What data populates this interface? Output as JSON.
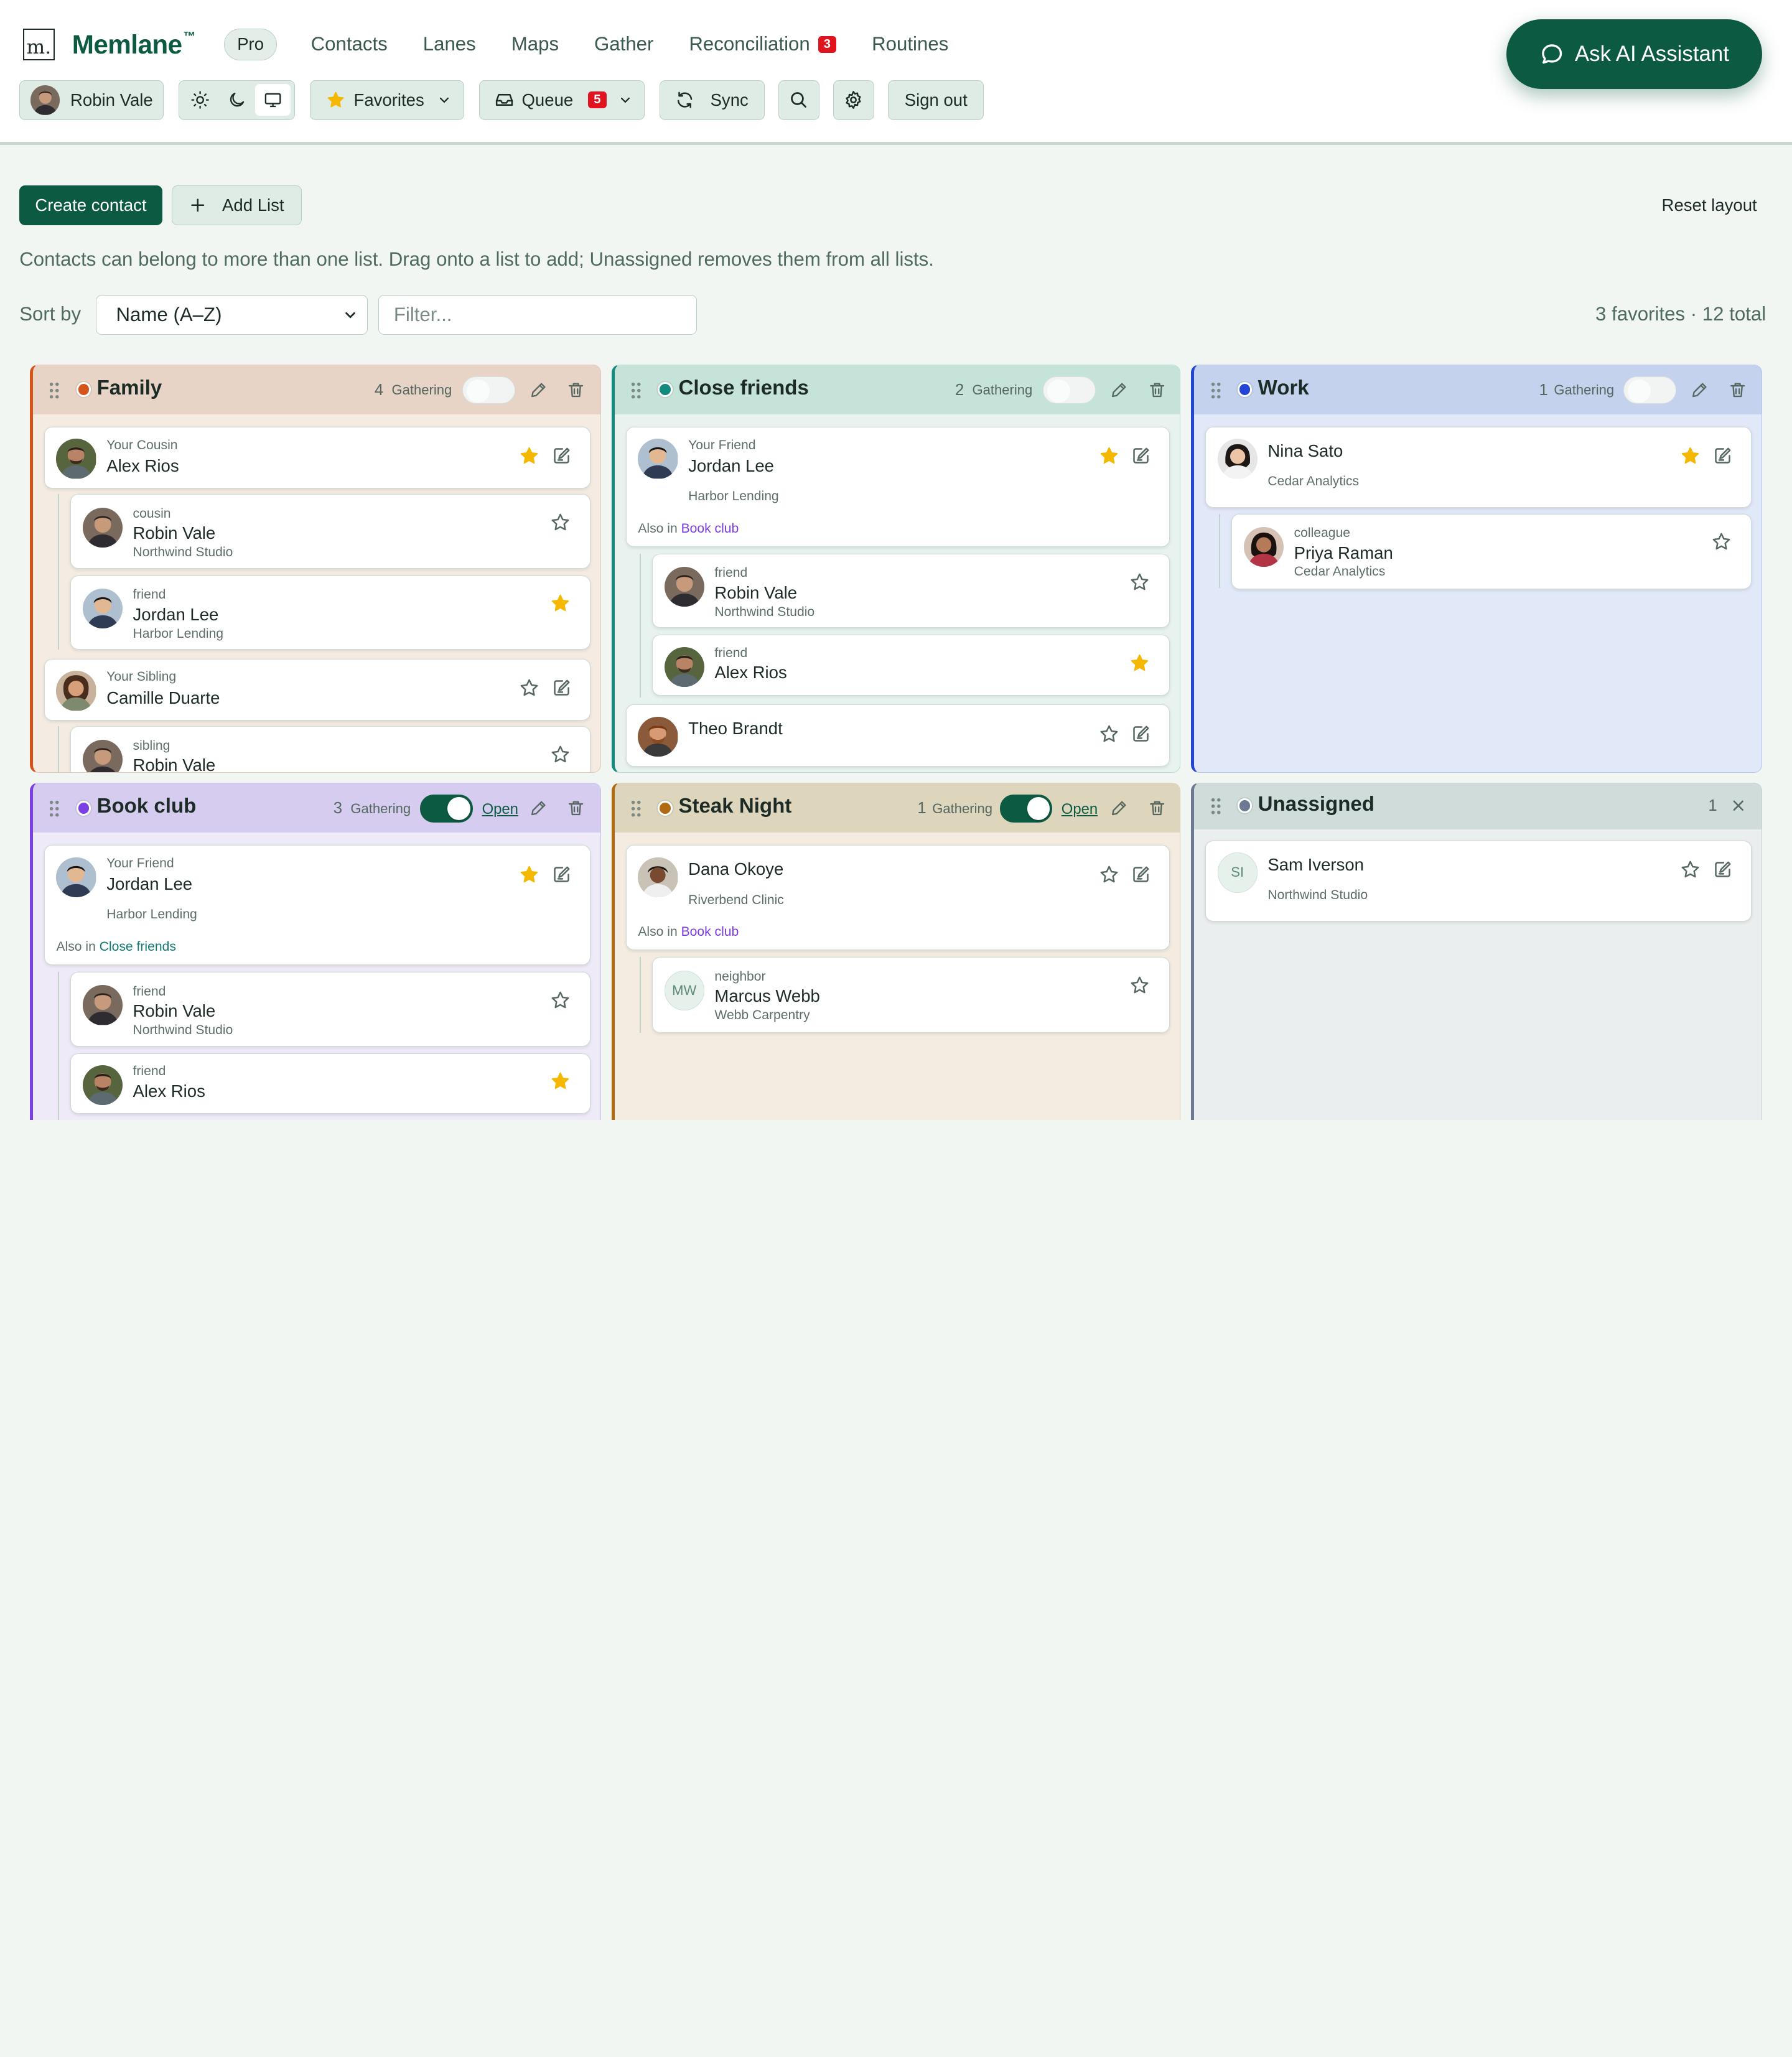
{
  "header": {
    "logo_letter": "m.",
    "brand": "Memlane",
    "trademark": "™",
    "plan": "Pro",
    "nav": [
      {
        "label": "Contacts"
      },
      {
        "label": "Lanes"
      },
      {
        "label": "Maps"
      },
      {
        "label": "Gather"
      },
      {
        "label": "Reconciliation",
        "badge": "3"
      },
      {
        "label": "Routines"
      }
    ],
    "ask_ai": "Ask AI Assistant",
    "user": "Robin Vale",
    "favorites": "Favorites",
    "queue": "Queue",
    "queue_badge": "5",
    "sync": "Sync",
    "sign_out": "Sign out",
    "theme_selected": "system"
  },
  "toolbar": {
    "create_contact": "Create contact",
    "add_list": "Add List",
    "reset_layout": "Reset layout",
    "hint": "Contacts can belong to more than one list. Drag onto a list to add; Unassigned removes them from all lists.",
    "sort_label": "Sort by",
    "sort_value": "Name (A–Z)",
    "filter_placeholder": "Filter...",
    "totals": "3 favorites · 12 total"
  },
  "gathering_label": "Gathering",
  "open_label": "Open",
  "also_in_label": "Also in",
  "colors": {
    "brand": "#0d5a43",
    "family": "#d4541a",
    "close_friends": "#128a7c",
    "work": "#2346d6",
    "book_club": "#7b3fe4",
    "steak_night": "#b06a12",
    "unassigned": "#6d7892",
    "star": "#f5b800"
  },
  "lanes": {
    "family": {
      "title": "Family",
      "count": "4",
      "gathering": false,
      "cards": [
        {
          "role": "Your Cousin",
          "name": "Alex Rios",
          "starred": true
        },
        {
          "role": "cousin",
          "name": "Robin Vale",
          "org": "Northwind Studio",
          "starred": false
        },
        {
          "role": "friend",
          "name": "Jordan Lee",
          "org": "Harbor Lending",
          "starred": true
        },
        {
          "role": "Your Sibling",
          "name": "Camille Duarte",
          "starred": false
        },
        {
          "role": "sibling",
          "name": "Robin Vale",
          "starred": false
        }
      ]
    },
    "close_friends": {
      "title": "Close friends",
      "count": "2",
      "gathering": false,
      "cards": [
        {
          "role": "Your Friend",
          "name": "Jordan Lee",
          "org": "Harbor Lending",
          "also_in": "Book club",
          "starred": true
        },
        {
          "role": "friend",
          "name": "Robin Vale",
          "org": "Northwind Studio",
          "starred": false
        },
        {
          "role": "friend",
          "name": "Alex Rios",
          "starred": true
        },
        {
          "name": "Theo Brandt",
          "starred": false
        }
      ]
    },
    "work": {
      "title": "Work",
      "count": "1",
      "gathering": false,
      "cards": [
        {
          "name": "Nina Sato",
          "org": "Cedar Analytics",
          "starred": true
        },
        {
          "role": "colleague",
          "name": "Priya Raman",
          "org": "Cedar Analytics",
          "starred": false
        }
      ]
    },
    "book_club": {
      "title": "Book club",
      "count": "3",
      "gathering": true,
      "cards": [
        {
          "role": "Your Friend",
          "name": "Jordan Lee",
          "org": "Harbor Lending",
          "also_in": "Close friends",
          "starred": true
        },
        {
          "role": "friend",
          "name": "Robin Vale",
          "org": "Northwind Studio",
          "starred": false
        },
        {
          "role": "friend",
          "name": "Alex Rios",
          "starred": true
        }
      ]
    },
    "steak_night": {
      "title": "Steak Night",
      "count": "1",
      "gathering": true,
      "cards": [
        {
          "name": "Dana Okoye",
          "org": "Riverbend Clinic",
          "also_in": "Book club",
          "starred": false
        },
        {
          "role": "neighbor",
          "name": "Marcus Webb",
          "org": "Webb Carpentry",
          "initials": "MW",
          "starred": false
        }
      ]
    },
    "unassigned": {
      "title": "Unassigned",
      "count": "1",
      "cards": [
        {
          "name": "Sam Iverson",
          "org": "Northwind Studio",
          "initials": "SI",
          "starred": false
        }
      ]
    }
  }
}
